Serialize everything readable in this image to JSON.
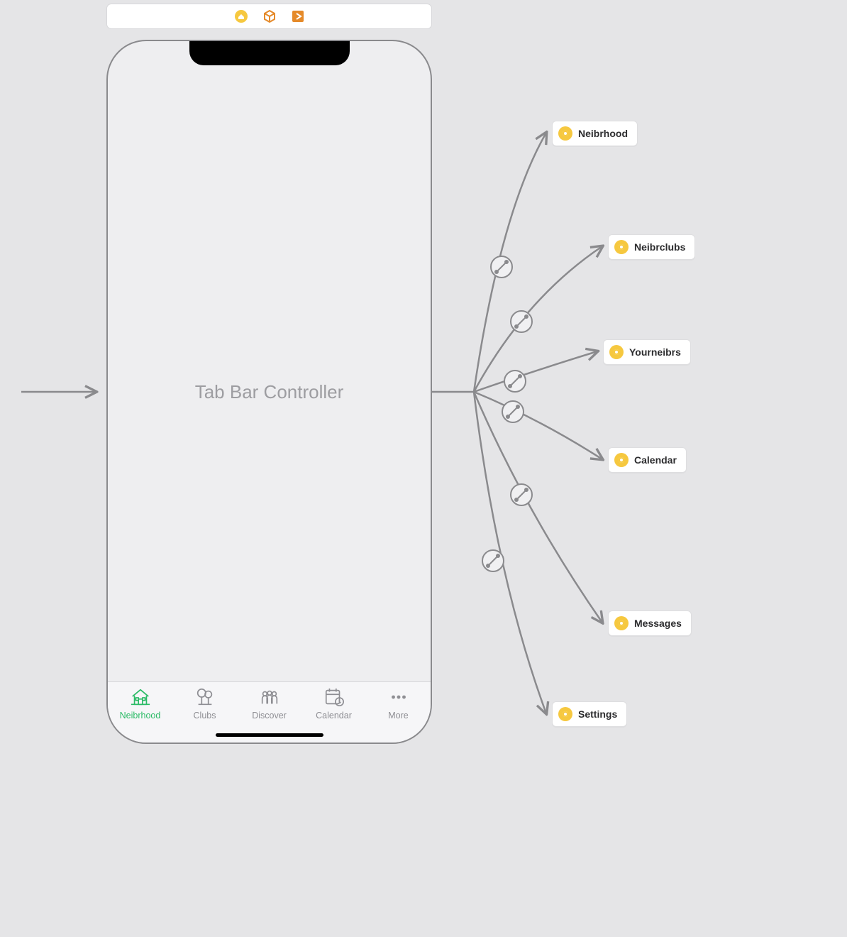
{
  "phone": {
    "title": "Tab Bar Controller",
    "tabs": [
      {
        "label": "Neibrhood",
        "active": true
      },
      {
        "label": "Clubs",
        "active": false
      },
      {
        "label": "Discover",
        "active": false
      },
      {
        "label": "Calendar",
        "active": false
      },
      {
        "label": "More",
        "active": false
      }
    ]
  },
  "destinations": [
    {
      "label": "Neibrhood"
    },
    {
      "label": "Neibrclubs"
    },
    {
      "label": "Yourneibrs"
    },
    {
      "label": "Calendar"
    },
    {
      "label": "Messages"
    },
    {
      "label": "Settings"
    }
  ]
}
